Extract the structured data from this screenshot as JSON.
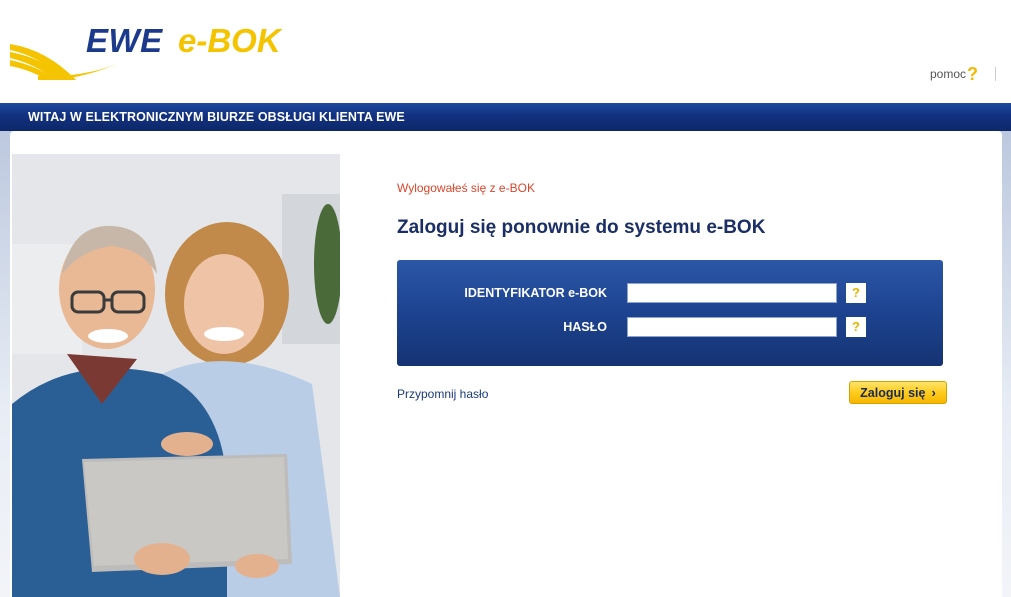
{
  "brand": {
    "name": "EWE",
    "product": "e-BOK",
    "colors": {
      "navy": "#1b3a8c",
      "yellow": "#f5c400",
      "bar": "#12317f",
      "alert": "#d9462b"
    }
  },
  "header": {
    "help_label": "pomoc",
    "help_icon": "?"
  },
  "topbar": {
    "title": "WITAJ W ELEKTRONICZNYM BIURZE OBSŁUGI KLIENTA EWE"
  },
  "login": {
    "logout_message": "Wylogowałeś się z e-BOK",
    "title": "Zaloguj się ponownie do systemu e-BOK",
    "fields": [
      {
        "label": "IDENTYFIKATOR e-BOK",
        "value": "",
        "help": "?"
      },
      {
        "label": "HASŁO",
        "value": "",
        "help": "?"
      }
    ],
    "remind_link": "Przypomnij hasło",
    "submit_label": "Zaloguj się",
    "submit_icon": "chevron-right-icon"
  },
  "hero_image": {
    "icon": "photo-couple-laptop"
  }
}
